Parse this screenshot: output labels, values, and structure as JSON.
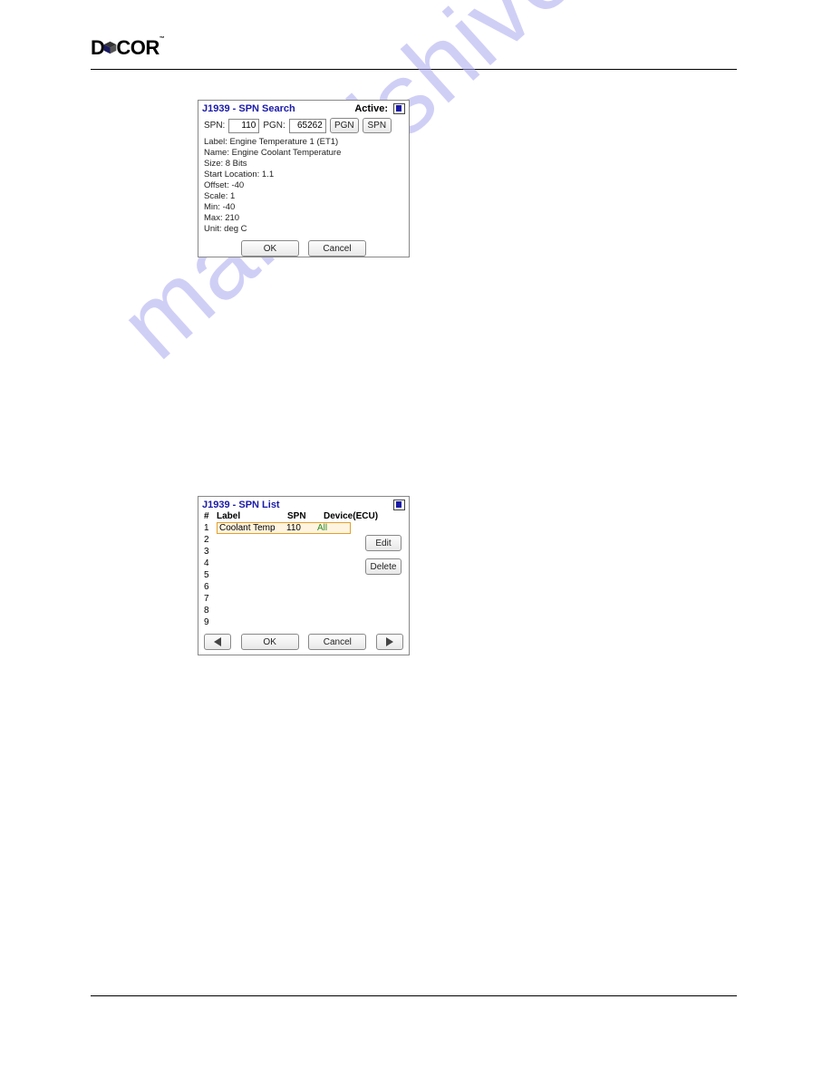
{
  "watermark": "manualshive.com",
  "logo": {
    "text_left": "D",
    "text_right": "COR",
    "tm": "™"
  },
  "dialog1": {
    "title": "J1939 - SPN Search",
    "active_label": "Active:",
    "spn_label": "SPN:",
    "spn_value": "110",
    "pgn_label": "PGN:",
    "pgn_value": "65262",
    "btn_pgn": "PGN",
    "btn_spn": "SPN",
    "fields": {
      "label": "Label: Engine Temperature 1 (ET1)",
      "name": "Name: Engine Coolant Temperature",
      "size": "Size: 8 Bits",
      "start": "Start Location: 1.1",
      "offset": "Offset: -40",
      "scale": "Scale: 1",
      "min": "Min: -40",
      "max": "Max: 210",
      "unit": "Unit: deg C"
    },
    "btn_ok": "OK",
    "btn_cancel": "Cancel"
  },
  "dialog2": {
    "title": "J1939 - SPN List",
    "headers": {
      "num": "#",
      "label": "Label",
      "spn": "SPN",
      "device": "Device(ECU)"
    },
    "row1": {
      "num": "1",
      "label": "Coolant Temp",
      "spn": "110",
      "device": "All"
    },
    "row_nums": [
      "2",
      "3",
      "4",
      "5",
      "6",
      "7",
      "8",
      "9"
    ],
    "btn_edit": "Edit",
    "btn_delete": "Delete",
    "btn_ok": "OK",
    "btn_cancel": "Cancel"
  }
}
